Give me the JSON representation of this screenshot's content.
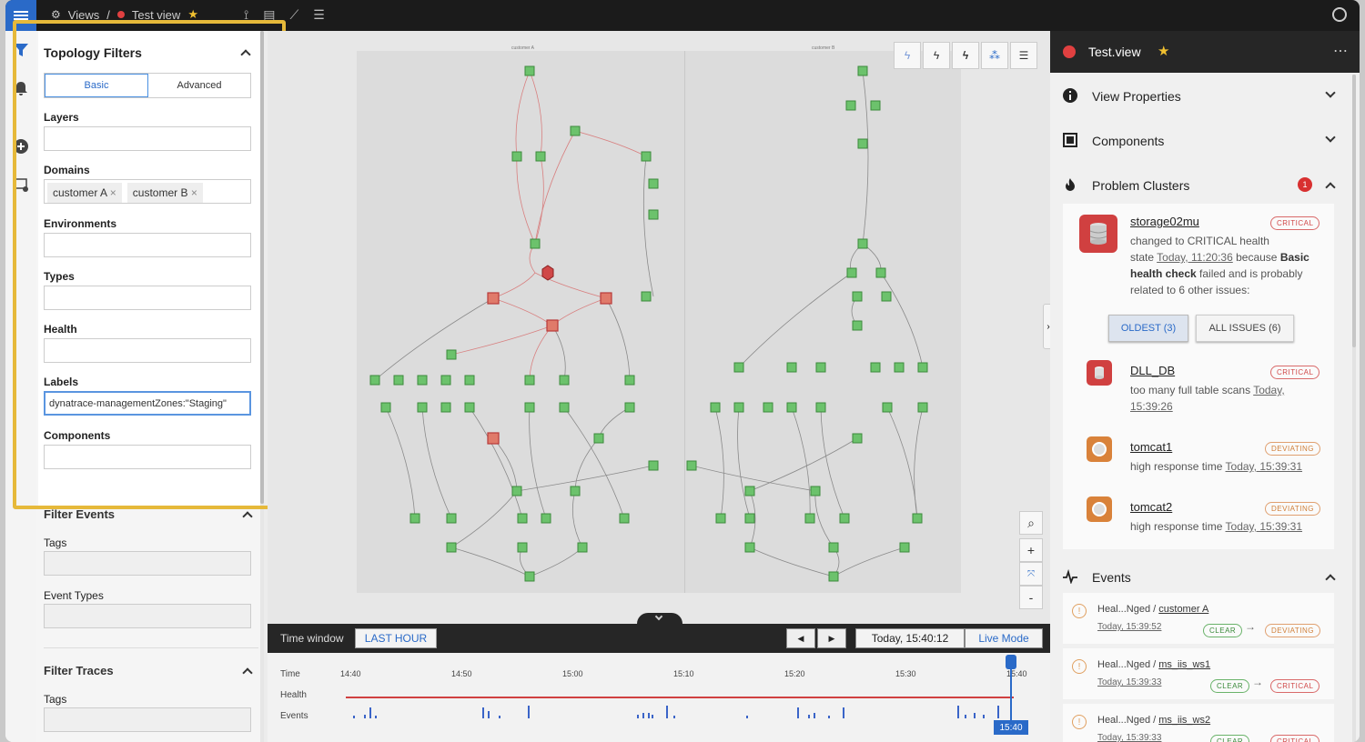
{
  "topbar": {
    "views": "Views",
    "separator": "/",
    "view_name": "Test view"
  },
  "filters": {
    "title": "Topology Filters",
    "tabs": [
      "Basic",
      "Advanced"
    ],
    "layers_label": "Layers",
    "domains_label": "Domains",
    "domains": [
      "customer A",
      "customer B"
    ],
    "environments_label": "Environments",
    "types_label": "Types",
    "health_label": "Health",
    "labels_label": "Labels",
    "labels_value": "dynatrace-managementZones:\"Staging\"",
    "components_label": "Components",
    "filter_events_title": "Filter Events",
    "tags_label": "Tags",
    "event_types_label": "Event Types",
    "filter_traces_title": "Filter Traces",
    "traces_tags_label": "Tags"
  },
  "timewindow": {
    "label": "Time window",
    "range_button": "LAST HOUR",
    "prev": "◀",
    "next": "▶",
    "current_time": "Today, 15:40:12",
    "live_mode": "Live Mode",
    "row_time": "Time",
    "row_health": "Health",
    "row_events": "Events",
    "ticks": [
      "14:40",
      "14:50",
      "15:00",
      "15:10",
      "15:20",
      "15:30",
      "15:40"
    ],
    "cursor_label": "15:40"
  },
  "right": {
    "view_title": "Test.view",
    "more": "⋯",
    "view_properties": "View Properties",
    "components": "Components",
    "problem_clusters": "Problem Clusters",
    "problem_count": "1",
    "problem": {
      "name": "storage02mu",
      "badge": "CRITICAL",
      "line1": "changed to CRITICAL health",
      "line2_pre": "state ",
      "line2_time": "Today, 11:20:36",
      "line2_post": " because ",
      "line2_bold": "Basic",
      "line3_bold": "health check",
      "line3_post": " failed and is probably",
      "line4": "related to 6 other issues:"
    },
    "btn_oldest": "OLDEST (3)",
    "btn_all": "ALL ISSUES (6)",
    "issues": [
      {
        "name": "DLL_DB",
        "badge": "CRITICAL",
        "text": "too many full table scans ",
        "time": "Today,",
        "time2": "15:39:26"
      },
      {
        "name": "tomcat1",
        "badge": "DEVIATING",
        "text": "high response time ",
        "time": "Today, 15:39:31"
      },
      {
        "name": "tomcat2",
        "badge": "DEVIATING",
        "text": "high response time ",
        "time": "Today, 15:39:31"
      }
    ],
    "events_title": "Events",
    "events": [
      {
        "title": "Heal...Nged / ",
        "target": "customer A",
        "time": "Today, 15:39:52",
        "from": "CLEAR",
        "to": "DEVIATING"
      },
      {
        "title": "Heal...Nged / ",
        "target": "ms_iis_ws1",
        "time": "Today, 15:39:33",
        "from": "CLEAR",
        "to": "CRITICAL"
      },
      {
        "title": "Heal...Nged / ",
        "target": "ms_iis_ws2",
        "time": "Today, 15:39:33",
        "from": "CLEAR",
        "to": "CRITICAL"
      }
    ]
  },
  "graph": {
    "domain_a": "customer A",
    "domain_b": "customer B"
  },
  "colors": {
    "accent": "#2a6ac8",
    "critical": "#d04848",
    "deviating": "#d0803a",
    "clear": "#3a8a3a",
    "highlight": "#e6b93a"
  }
}
